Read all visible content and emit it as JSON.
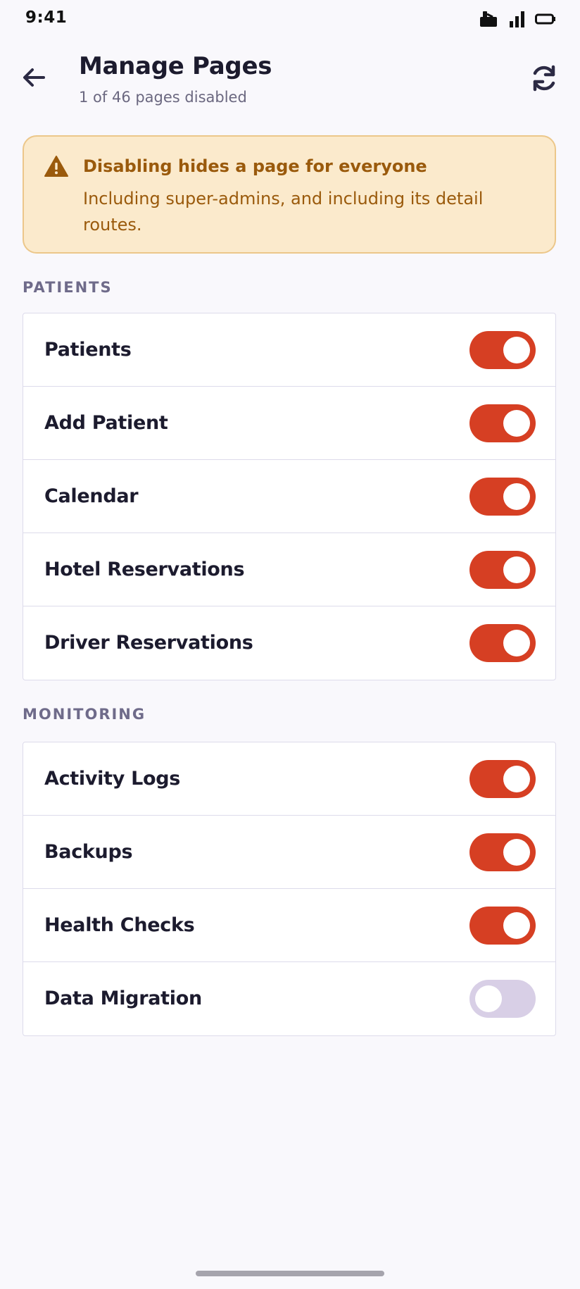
{
  "status_bar": {
    "time": "9:41",
    "icons": [
      "notification-icon",
      "signal-icon",
      "battery-icon"
    ]
  },
  "header": {
    "title": "Manage Pages",
    "subtitle": "1 of 46 pages disabled",
    "back_icon": "back-arrow-icon",
    "refresh_icon": "refresh-icon"
  },
  "warning": {
    "icon": "warning-icon",
    "title": "Disabling hides a page for everyone",
    "body": "Including super-admins, and including its detail routes."
  },
  "sections": [
    {
      "label": "PATIENTS",
      "items": [
        {
          "label": "Patients",
          "enabled": true
        },
        {
          "label": "Add Patient",
          "enabled": true
        },
        {
          "label": "Calendar",
          "enabled": true
        },
        {
          "label": "Hotel Reservations",
          "enabled": true
        },
        {
          "label": "Driver Reservations",
          "enabled": true
        }
      ]
    },
    {
      "label": "MONITORING",
      "items": [
        {
          "label": "Activity Logs",
          "enabled": true
        },
        {
          "label": "Backups",
          "enabled": true
        },
        {
          "label": "Health Checks",
          "enabled": true
        },
        {
          "label": "Data Migration",
          "enabled": false
        }
      ]
    }
  ],
  "colors": {
    "toggle_on": "#d63f23",
    "toggle_off": "#d8cfe6",
    "warning_bg": "#fbeacc",
    "warning_text": "#9a5a0c",
    "background": "#f9f8fc"
  }
}
